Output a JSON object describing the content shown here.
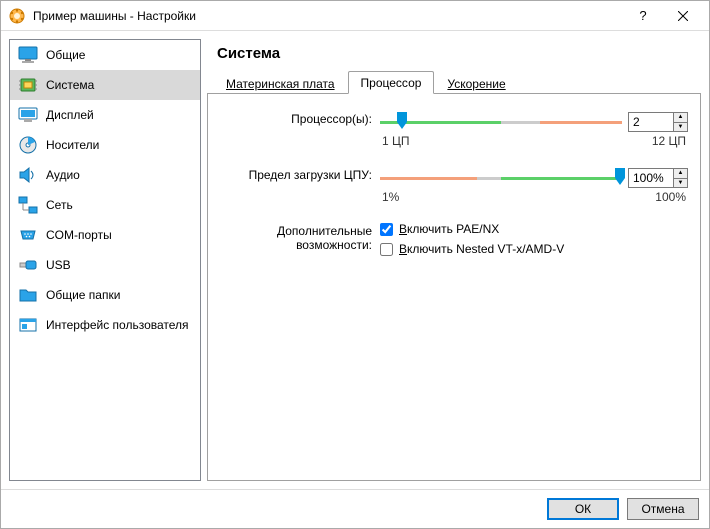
{
  "window": {
    "title": "Пример машины - Настройки",
    "help": "?",
    "close": "×"
  },
  "sidebar": {
    "items": [
      {
        "label": "Общие"
      },
      {
        "label": "Система"
      },
      {
        "label": "Дисплей"
      },
      {
        "label": "Носители"
      },
      {
        "label": "Аудио"
      },
      {
        "label": "Сеть"
      },
      {
        "label": "COM-порты"
      },
      {
        "label": "USB"
      },
      {
        "label": "Общие папки"
      },
      {
        "label": "Интерфейс пользователя"
      }
    ],
    "selected_index": 1
  },
  "main": {
    "title": "Система",
    "tabs": [
      {
        "label": "Материнская плата"
      },
      {
        "label": "Процессор"
      },
      {
        "label": "Ускорение"
      }
    ],
    "active_tab": 1,
    "cpu": {
      "label": "Процессор(ы):",
      "value": "2",
      "min_label": "1 ЦП",
      "max_label": "12 ЦП"
    },
    "execcap": {
      "label": "Предел загрузки ЦПУ:",
      "value": "100%",
      "min_label": "1%",
      "max_label": "100%"
    },
    "extras": {
      "label": "Дополнительные возможности:",
      "pae_label": "Включить PAE/NX",
      "pae_checked": true,
      "nested_label": "Включить Nested VT-x/AMD-V",
      "nested_checked": false
    }
  },
  "buttons": {
    "ok": "ОК",
    "cancel": "Отмена"
  }
}
